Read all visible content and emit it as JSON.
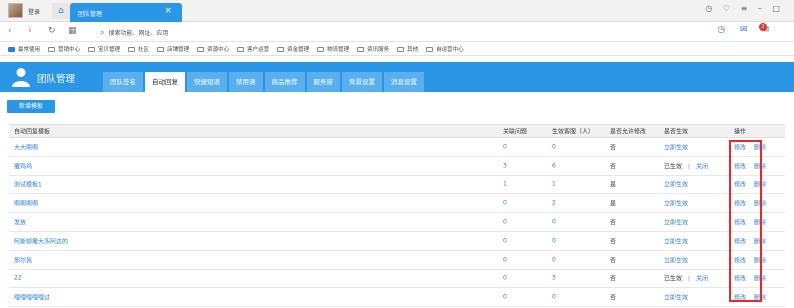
{
  "browser": {
    "login_label": "登录",
    "tab_title": "团队管理",
    "tab_close": "×",
    "win_controls": "◷ ♡ ≡ – □",
    "address": "搜索功能、网址、应用",
    "bookmarks": [
      "最常使用",
      "营销中心",
      "宝贝管理",
      "社区",
      "店铺管理",
      "资源中心",
      "客户运营",
      "资金管理",
      "物流管理",
      "资讯服务",
      "其他",
      "自运营中心"
    ],
    "notif_count": "2"
  },
  "app": {
    "title": "团队管理",
    "tabs": [
      "团队签名",
      "自动回复",
      "快捷短语",
      "禁用语",
      "商品推荐",
      "服务窗",
      "背景设置",
      "消息设置"
    ],
    "active_tab_index": 1,
    "add_button": "新增模板"
  },
  "table": {
    "headers": {
      "name": "自动回复模板",
      "related": "关联问题",
      "effective": "生效客服（人）",
      "allow": "是否允许修改",
      "status": "是否生效",
      "ops": "操作"
    },
    "rows": [
      {
        "name": "大大啊啊",
        "related": "0",
        "effective": "0",
        "allow": "否",
        "status": "立即生效",
        "close": ""
      },
      {
        "name": "撒鸡鸡",
        "related": "3",
        "effective": "6",
        "allow": "否",
        "status": "已生效",
        "close": "关闭"
      },
      {
        "name": "测试模板1",
        "related": "1",
        "effective": "1",
        "allow": "是",
        "status": "立即生效",
        "close": ""
      },
      {
        "name": "啊啊啊啊",
        "related": "0",
        "effective": "2",
        "allow": "是",
        "status": "立即生效",
        "close": ""
      },
      {
        "name": "发放",
        "related": "0",
        "effective": "0",
        "allow": "否",
        "status": "立即生效",
        "close": ""
      },
      {
        "name": "阿斯顿撒大多阿达的",
        "related": "0",
        "effective": "0",
        "allow": "否",
        "status": "立即生效",
        "close": ""
      },
      {
        "name": "邢尔我",
        "related": "0",
        "effective": "0",
        "allow": "否",
        "status": "立即生效",
        "close": ""
      },
      {
        "name": "22",
        "related": "0",
        "effective": "3",
        "allow": "否",
        "status": "已生效",
        "close": "关闭"
      },
      {
        "name": "嘎嘎嘎嘎嘎过",
        "related": "0",
        "effective": "0",
        "allow": "否",
        "status": "立即生效",
        "close": ""
      }
    ],
    "edit_label": "修改",
    "delete_label": "删除",
    "separator": "|"
  },
  "colors": {
    "accent": "#2b95e6",
    "highlight": "#e5282a",
    "link": "#2b7fd6"
  }
}
